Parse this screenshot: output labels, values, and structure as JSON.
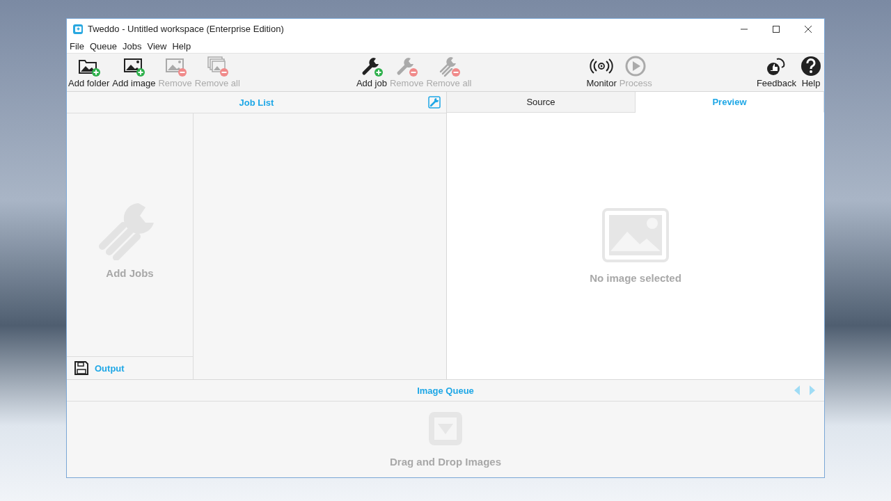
{
  "window": {
    "title": "Tweddo - Untitled workspace (Enterprise Edition)"
  },
  "menu": [
    "File",
    "Queue",
    "Jobs",
    "View",
    "Help"
  ],
  "toolbar": [
    [
      {
        "kind": "folder-add",
        "label": "Add folder",
        "disabled": false
      },
      {
        "kind": "image-add",
        "label": "Add image",
        "disabled": false
      },
      {
        "kind": "image-remove",
        "label": "Remove",
        "disabled": true
      },
      {
        "kind": "images-remove",
        "label": "Remove all",
        "disabled": true
      }
    ],
    [
      {
        "kind": "wrench-add",
        "label": "Add job",
        "disabled": false
      },
      {
        "kind": "wrench-remove",
        "label": "Remove",
        "disabled": true
      },
      {
        "kind": "wrenches-remove",
        "label": "Remove all",
        "disabled": true
      }
    ],
    [
      {
        "kind": "monitor",
        "label": "Monitor",
        "disabled": false
      },
      {
        "kind": "play",
        "label": "Process",
        "disabled": true
      }
    ],
    [
      {
        "kind": "feedback",
        "label": "Feedback",
        "disabled": false
      },
      {
        "kind": "help",
        "label": "Help",
        "disabled": false
      }
    ]
  ],
  "job_list": {
    "title": "Job List",
    "empty_text": "Add Jobs",
    "output_label": "Output"
  },
  "preview_tabs": [
    {
      "label": "Source",
      "selected": false
    },
    {
      "label": "Preview",
      "selected": true
    }
  ],
  "preview": {
    "empty_text": "No image selected"
  },
  "image_queue": {
    "title": "Image Queue",
    "empty_text": "Drag and Drop Images"
  }
}
